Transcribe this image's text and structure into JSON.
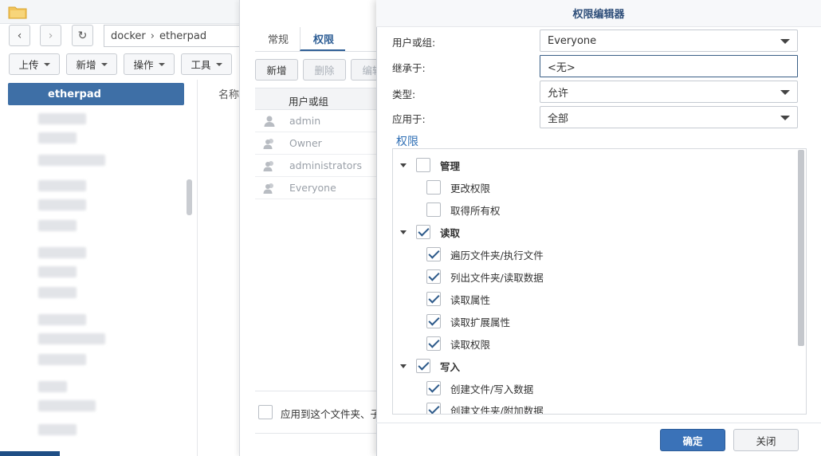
{
  "file_station": {
    "path": [
      "docker",
      "etherpad"
    ],
    "toolbar": [
      "上传",
      "新增",
      "操作",
      "工具"
    ],
    "tree_selected": "etherpad",
    "column_name": "名称"
  },
  "properties": {
    "tabs": [
      "常规",
      "权限"
    ],
    "active_tab": "权限",
    "buttons": [
      "新增",
      "删除",
      "编辑"
    ],
    "column_user": "用户或组",
    "rows": [
      "admin",
      "Owner",
      "administrators",
      "Everyone"
    ],
    "apply_label": "应用到这个文件夹、子"
  },
  "editor": {
    "title": "权限编辑器",
    "fields": {
      "user_label": "用户或组:",
      "user_value": "Everyone",
      "inherit_label": "继承于:",
      "inherit_value": "<无>",
      "type_label": "类型:",
      "type_value": "允许",
      "apply_label": "应用于:",
      "apply_value": "全部"
    },
    "section_title": "权限",
    "groups": [
      {
        "label": "管理",
        "checked": false,
        "items": [
          {
            "label": "更改权限",
            "checked": false
          },
          {
            "label": "取得所有权",
            "checked": false
          }
        ]
      },
      {
        "label": "读取",
        "checked": true,
        "items": [
          {
            "label": "遍历文件夹/执行文件",
            "checked": true
          },
          {
            "label": "列出文件夹/读取数据",
            "checked": true
          },
          {
            "label": "读取属性",
            "checked": true
          },
          {
            "label": "读取扩展属性",
            "checked": true
          },
          {
            "label": "读取权限",
            "checked": true
          }
        ]
      },
      {
        "label": "写入",
        "checked": true,
        "items": [
          {
            "label": "创建文件/写入数据",
            "checked": true
          },
          {
            "label": "创建文件夹/附加数据",
            "checked": true
          }
        ]
      }
    ],
    "ok_label": "确定",
    "close_label": "关闭"
  },
  "colors": {
    "accent": "#3a72b8",
    "tree_selected": "#3e6fa6"
  }
}
